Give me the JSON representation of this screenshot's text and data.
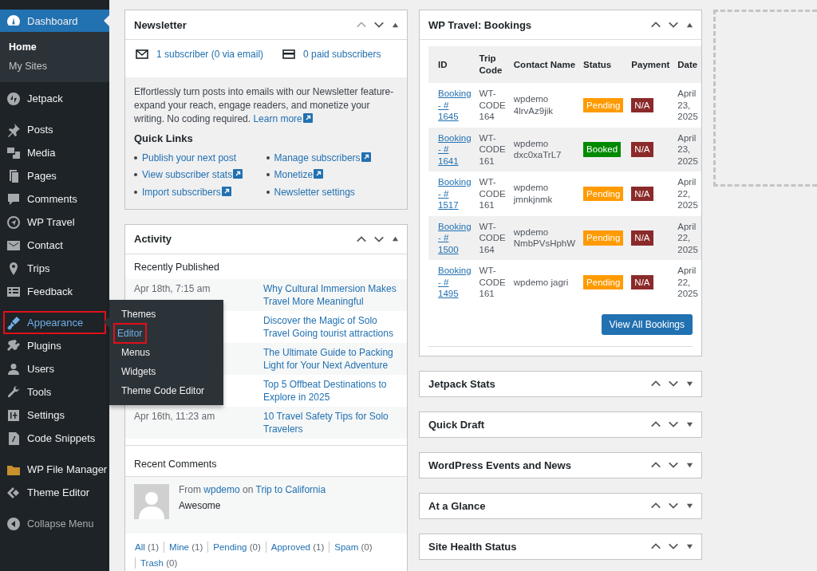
{
  "sidebar": {
    "groups": [
      [
        {
          "label": "Dashboard",
          "selected": true,
          "outlined": false,
          "children": [
            {
              "label": "Home",
              "selected": true
            },
            {
              "label": "My Sites",
              "selected": false
            }
          ]
        }
      ],
      [
        {
          "label": "Jetpack",
          "selected": false,
          "outlined": false
        }
      ],
      [
        {
          "label": "Posts",
          "selected": false,
          "outlined": false
        },
        {
          "label": "Media",
          "selected": false,
          "outlined": false
        },
        {
          "label": "Pages",
          "selected": false,
          "outlined": false
        },
        {
          "label": "Comments",
          "selected": false,
          "outlined": false
        },
        {
          "label": "WP Travel",
          "selected": false,
          "outlined": false
        },
        {
          "label": "Contact",
          "selected": false,
          "outlined": false
        },
        {
          "label": "Trips",
          "selected": false,
          "outlined": false
        },
        {
          "label": "Feedback",
          "selected": false,
          "outlined": false
        }
      ],
      [
        {
          "label": "Appearance",
          "selected": false,
          "outlined": true,
          "flyout": [
            {
              "label": "Themes",
              "selected": false,
              "outlined": false
            },
            {
              "label": "Editor",
              "selected": true,
              "outlined": true
            },
            {
              "label": "Menus",
              "selected": false,
              "outlined": false
            },
            {
              "label": "Widgets",
              "selected": false,
              "outlined": false
            },
            {
              "label": "Theme Code Editor",
              "selected": false,
              "outlined": false
            }
          ]
        },
        {
          "label": "Plugins",
          "selected": false,
          "outlined": false
        },
        {
          "label": "Users",
          "selected": false,
          "outlined": false
        },
        {
          "label": "Tools",
          "selected": false,
          "outlined": false
        },
        {
          "label": "Settings",
          "selected": false,
          "outlined": false
        },
        {
          "label": "Code Snippets",
          "selected": false,
          "outlined": false
        }
      ],
      [
        {
          "label": "WP File Manager",
          "selected": false,
          "outlined": false
        },
        {
          "label": "Theme Editor",
          "selected": false,
          "outlined": false
        }
      ]
    ],
    "collapse_label": "Collapse Menu"
  },
  "newsletter": {
    "title": "Newsletter",
    "expanded": true,
    "can_move_up": false,
    "stats": [
      {
        "label": "1 subscriber (0 via email)"
      },
      {
        "label": "0 paid subscribers"
      }
    ],
    "description": "Effortlessly turn posts into emails with our Newsletter feature-expand your reach, engage readers, and monetize your writing. No coding required.",
    "learn_more": "Learn more",
    "quick_links_heading": "Quick Links",
    "quick_links": [
      {
        "label": "Publish your next post",
        "external": false
      },
      {
        "label": "View subscriber stats",
        "external": true
      },
      {
        "label": "Import subscribers",
        "external": true
      },
      {
        "label": "Manage subscribers",
        "external": true
      },
      {
        "label": "Monetize",
        "external": true
      },
      {
        "label": "Newsletter settings",
        "external": false
      }
    ]
  },
  "activity": {
    "title": "Activity",
    "expanded": true,
    "can_move_up": true,
    "published_heading": "Recently Published",
    "posts": [
      {
        "date": "Apr 18th, 7:15 am",
        "title": "Why Cultural Immersion Makes Travel More Meaningful"
      },
      {
        "title": "Discover the Magic of Solo Travel Going tourist attractions"
      },
      {
        "title": "The Ultimate Guide to Packing Light for Your Next Adventure"
      },
      {
        "title": "Top 5 Offbeat Destinations to Explore in 2025"
      },
      {
        "date": "Apr 16th, 11:23 am",
        "title": "10 Travel Safety Tips for Solo Travelers"
      }
    ],
    "comments_heading": "Recent Comments",
    "comments": [
      {
        "from": "From",
        "author": "wpdemo",
        "on": "on",
        "post": "Trip to California",
        "text": "Awesome"
      }
    ],
    "filters": [
      {
        "label": "All",
        "count": "(1)"
      },
      {
        "label": "Mine",
        "count": "(1)"
      },
      {
        "label": "Pending",
        "count": "(0)"
      },
      {
        "label": "Approved",
        "count": "(1)"
      },
      {
        "label": "Spam",
        "count": "(0)"
      },
      {
        "label": "Trash",
        "count": "(0)"
      }
    ]
  },
  "bookings": {
    "title": "WP Travel: Bookings",
    "expanded": true,
    "can_move_up": true,
    "columns": [
      "ID",
      "Trip Code",
      "Contact Name",
      "Status",
      "Payment",
      "Date"
    ],
    "rows": [
      {
        "id": "Booking - # 1645",
        "trip_code": "WT-CODE 164",
        "contact": "wpdemo 4lrvAz9jik",
        "status": "Pending",
        "color": "#ff9b00",
        "payment": "N/A",
        "date": "April 23, 2025"
      },
      {
        "id": "Booking - # 1641",
        "trip_code": "WT-CODE 161",
        "contact": "wpdemo dxc0xaTrL7",
        "status": "Booked",
        "color": "#008a00",
        "payment": "N/A",
        "date": "April 23, 2025"
      },
      {
        "id": "Booking - # 1517",
        "trip_code": "WT-CODE 161",
        "contact": "wpdemo jmnkjnmk",
        "status": "Pending",
        "color": "#ff9b00",
        "payment": "N/A",
        "date": "April 22, 2025"
      },
      {
        "id": "Booking - # 1500",
        "trip_code": "WT-CODE 164",
        "contact": "wpdemo NmbPVsHphW",
        "status": "Pending",
        "color": "#ff9b00",
        "payment": "N/A",
        "date": "April 22, 2025"
      },
      {
        "id": "Booking - # 1495",
        "trip_code": "WT-CODE 161",
        "contact": "wpdemo jagri",
        "status": "Pending",
        "color": "#ff9b00",
        "payment": "N/A",
        "date": "April 22, 2025"
      }
    ],
    "button": "View All Bookings"
  },
  "collapsed_panels": [
    {
      "title": "Jetpack Stats",
      "expanded": false,
      "can_move_up": true
    },
    {
      "title": "Quick Draft",
      "expanded": false,
      "can_move_up": true
    },
    {
      "title": "WordPress Events and News",
      "expanded": false,
      "can_move_up": true
    },
    {
      "title": "At a Glance",
      "expanded": false,
      "can_move_up": true
    },
    {
      "title": "Site Health Status",
      "expanded": false,
      "can_move_up": true
    }
  ]
}
